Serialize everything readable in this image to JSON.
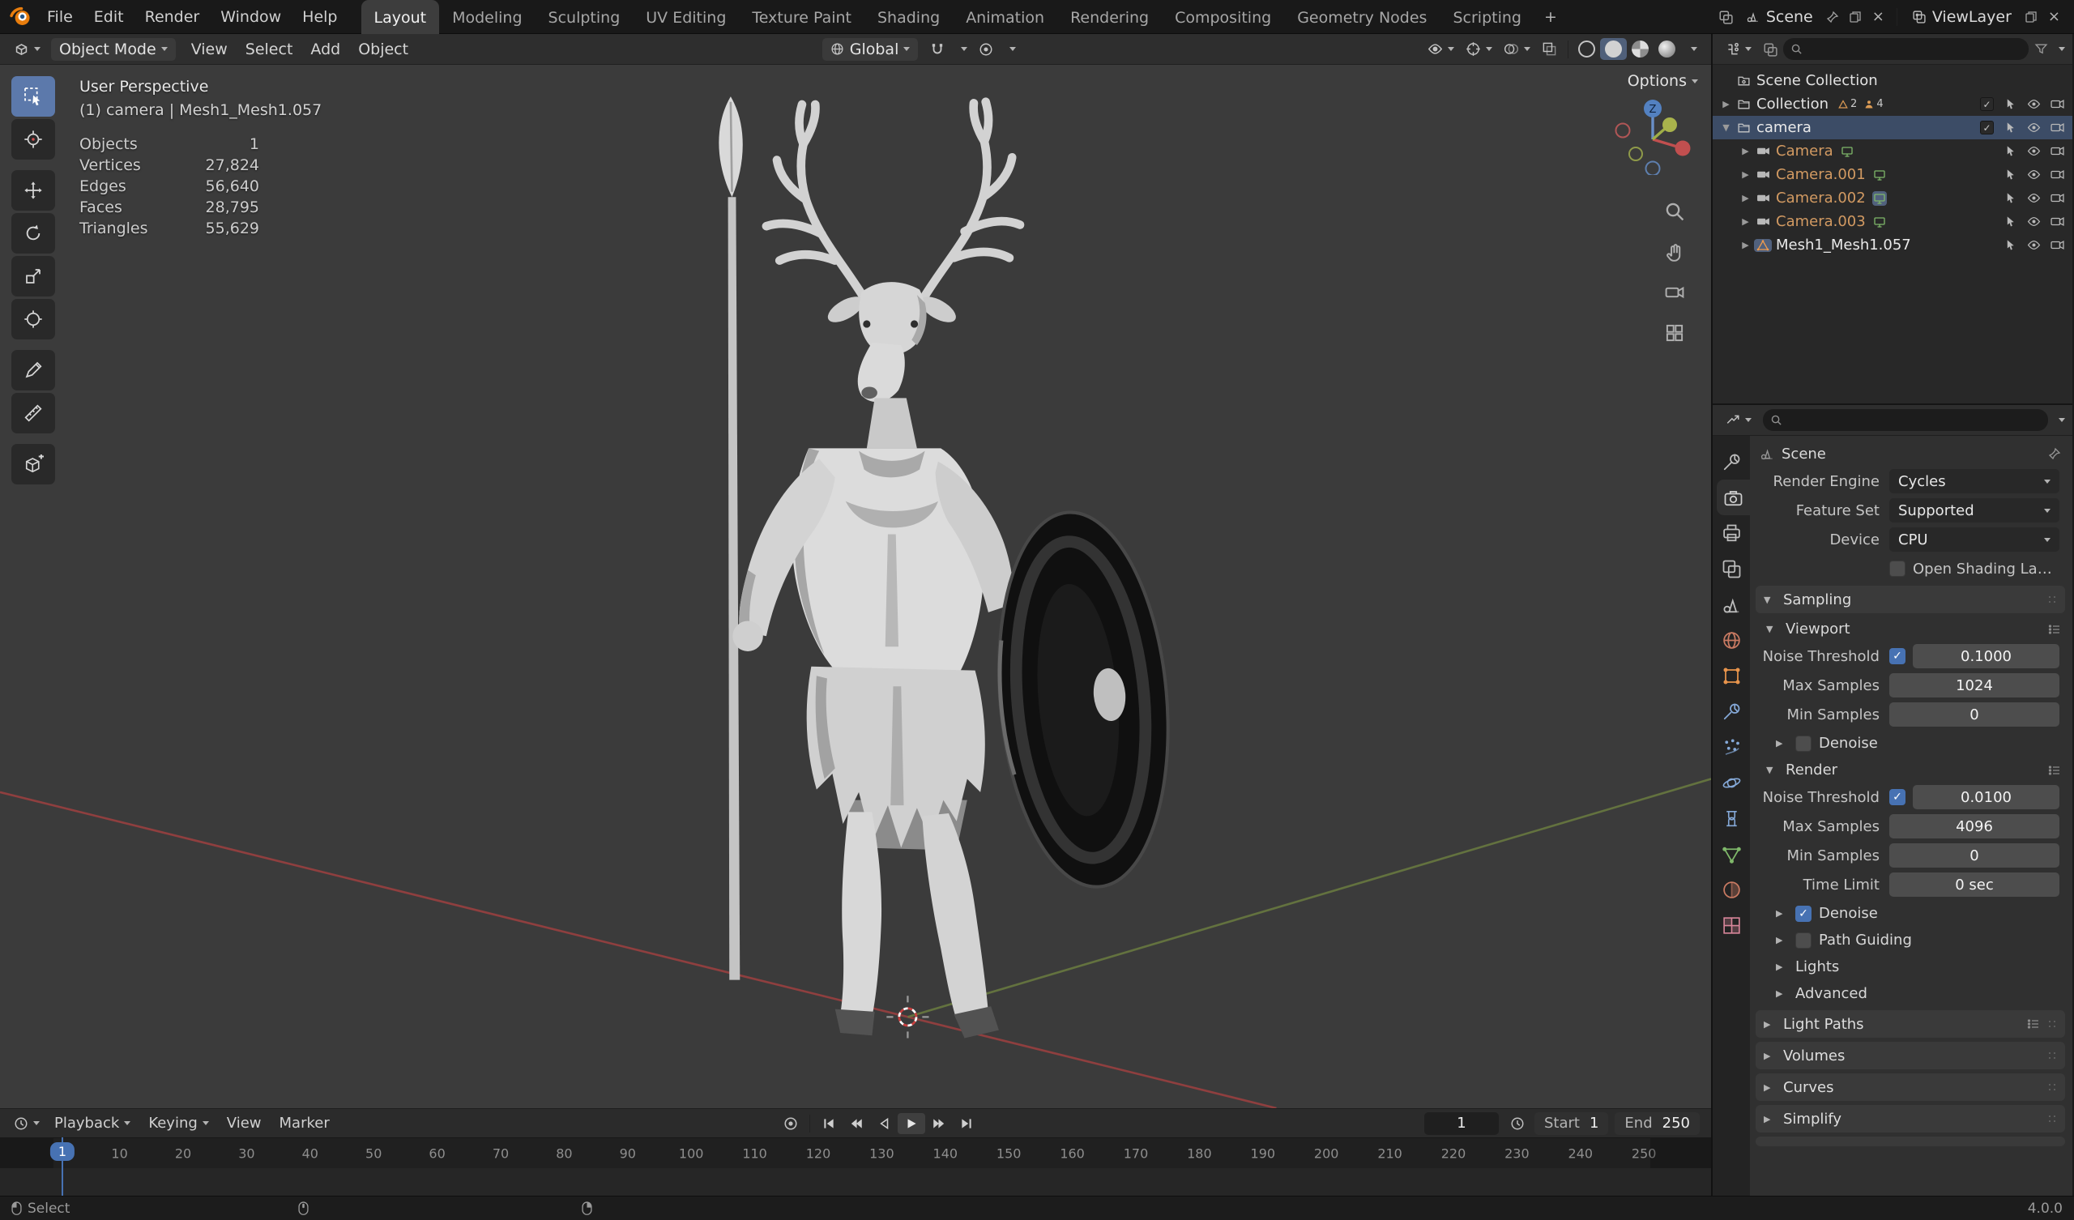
{
  "colors": {
    "accent": "#4772b3",
    "selected_text": "#d29a62",
    "mesh_orange": "#ef9b4e",
    "camera_green": "#7fb86a",
    "axis_x": "#9e4040",
    "axis_y": "#6b7c40"
  },
  "topbar": {
    "menus": [
      "File",
      "Edit",
      "Render",
      "Window",
      "Help"
    ],
    "workspaces": [
      "Layout",
      "Modeling",
      "Sculpting",
      "UV Editing",
      "Texture Paint",
      "Shading",
      "Animation",
      "Rendering",
      "Compositing",
      "Geometry Nodes",
      "Scripting"
    ],
    "active_workspace": "Layout",
    "new_workspace": "+",
    "scene": "Scene",
    "viewlayer": "ViewLayer"
  },
  "viewport_header": {
    "mode": "Object Mode",
    "menus": [
      "View",
      "Select",
      "Add",
      "Object"
    ],
    "orientation": "Global"
  },
  "viewport": {
    "options": "Options",
    "overlay_title": "User Perspective",
    "overlay_context": "(1) camera | Mesh1_Mesh1.057",
    "gizmo_z": "Z",
    "stats": [
      {
        "label": "Objects",
        "value": "1"
      },
      {
        "label": "Vertices",
        "value": "27,824"
      },
      {
        "label": "Edges",
        "value": "56,640"
      },
      {
        "label": "Faces",
        "value": "28,795"
      },
      {
        "label": "Triangles",
        "value": "55,629"
      }
    ]
  },
  "outliner": {
    "rows": [
      {
        "name": "Scene Collection",
        "depth": 0,
        "icon": "scene-collection",
        "expander": "",
        "text": "#e2e2e2",
        "right": []
      },
      {
        "name": "Collection",
        "depth": 0,
        "icon": "collection",
        "expander": "collapsed",
        "text": "#e2e2e2",
        "badges": [
          {
            "icon": "mesh-badge",
            "count": "2"
          },
          {
            "icon": "object-badge",
            "count": "4"
          }
        ],
        "right": [
          "checkbox",
          "cursor",
          "eye",
          "camera"
        ]
      },
      {
        "name": "camera",
        "depth": 0,
        "icon": "collection",
        "expander": "expanded",
        "selected": true,
        "text": "#eaeaea",
        "right": [
          "checkbox",
          "cursor",
          "eye",
          "camera"
        ]
      },
      {
        "name": "Camera",
        "depth": 1,
        "icon": "camera-object",
        "expander": "collapsed",
        "text": "#d29a62",
        "trailing": true,
        "right": [
          "cursor",
          "eye",
          "camera"
        ]
      },
      {
        "name": "Camera.001",
        "depth": 1,
        "icon": "camera-object",
        "expander": "collapsed",
        "text": "#d29a62",
        "trailing": true,
        "right": [
          "cursor",
          "eye",
          "camera"
        ]
      },
      {
        "name": "Camera.002",
        "depth": 1,
        "icon": "camera-object",
        "expander": "collapsed",
        "text": "#d29a62",
        "trailing": true,
        "trailing_active": true,
        "right": [
          "cursor",
          "eye",
          "camera"
        ]
      },
      {
        "name": "Camera.003",
        "depth": 1,
        "icon": "camera-object",
        "expander": "collapsed",
        "text": "#d29a62",
        "trailing": true,
        "right": [
          "cursor",
          "eye",
          "camera"
        ]
      },
      {
        "name": "Mesh1_Mesh1.057",
        "depth": 1,
        "icon": "mesh-object",
        "expander": "collapsed",
        "icon_active": true,
        "text": "#eaeaea",
        "right": [
          "cursor",
          "eye",
          "camera"
        ]
      }
    ]
  },
  "properties": {
    "breadcrumb": "Scene",
    "tabs": [
      "tool",
      "render",
      "output",
      "view-layer",
      "scene",
      "world",
      "object",
      "modifiers",
      "particles",
      "physics",
      "constraints",
      "object-data",
      "material",
      "texture"
    ],
    "active_tab": "render",
    "render_engine": {
      "label": "Render Engine",
      "value": "Cycles"
    },
    "feature_set": {
      "label": "Feature Set",
      "value": "Supported"
    },
    "device": {
      "label": "Device",
      "value": "CPU"
    },
    "osl": {
      "label": "Open Shading Langu...",
      "checked": false
    },
    "sampling": {
      "label": "Sampling"
    },
    "viewport_panel": {
      "label": "Viewport"
    },
    "vp_noise": {
      "label": "Noise Threshold",
      "value": "0.1000",
      "checked": true
    },
    "vp_max": {
      "label": "Max Samples",
      "value": "1024"
    },
    "vp_min": {
      "label": "Min Samples",
      "value": "0"
    },
    "vp_denoise": {
      "label": "Denoise",
      "checked": false
    },
    "render_panel": {
      "label": "Render"
    },
    "r_noise": {
      "label": "Noise Threshold",
      "value": "0.0100",
      "checked": true
    },
    "r_max": {
      "label": "Max Samples",
      "value": "4096"
    },
    "r_min": {
      "label": "Min Samples",
      "value": "0"
    },
    "time_limit": {
      "label": "Time Limit",
      "value": "0 sec"
    },
    "r_denoise": {
      "label": "Denoise",
      "checked": true
    },
    "path_guiding": {
      "label": "Path Guiding",
      "checked": false
    },
    "lights": {
      "label": "Lights"
    },
    "advanced": {
      "label": "Advanced"
    },
    "light_paths": {
      "label": "Light Paths"
    },
    "volumes": {
      "label": "Volumes"
    },
    "curves": {
      "label": "Curves"
    },
    "simplify": {
      "label": "Simplify"
    }
  },
  "timeline": {
    "menus": [
      "Playback",
      "Keying",
      "View",
      "Marker"
    ],
    "current_frame": "1",
    "start_label": "Start",
    "start_value": "1",
    "end_label": "End",
    "end_value": "250",
    "ruler": {
      "first": 10,
      "step": 10,
      "last": 250
    }
  },
  "statusbar": {
    "select": "Select",
    "version": "4.0.0"
  }
}
